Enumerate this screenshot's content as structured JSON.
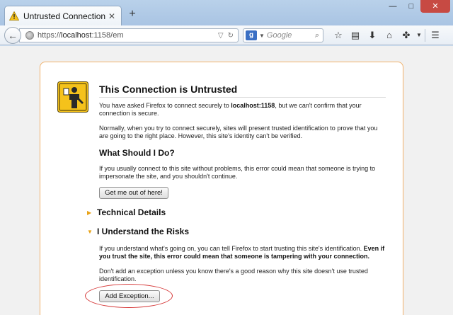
{
  "browser": {
    "tab_title": "Untrusted Connection",
    "new_tab_label": "+",
    "window_controls": {
      "minimize": "—",
      "maximize": "□",
      "close": "✕"
    },
    "url": {
      "prefix": "https://",
      "host": "localhost",
      "rest": ":1158/em"
    },
    "search": {
      "engine": "g",
      "placeholder": "Google"
    },
    "icons": [
      "star-icon",
      "clipboard-icon",
      "download-icon",
      "home-icon",
      "extension-icon",
      "menu-icon"
    ]
  },
  "page": {
    "title": "This Connection is Untrusted",
    "intro_prefix": "You have asked Firefox to connect securely to ",
    "intro_host": "localhost:1158",
    "intro_suffix": ", but we can't confirm that your connection is secure.",
    "normally": "Normally, when you try to connect securely, sites will present trusted identification to prove that you are going to the right place. However, this site's identity can't be verified.",
    "what_heading": "What Should I Do?",
    "what_text": "If you usually connect to this site without problems, this error could mean that someone is trying to impersonate the site, and you shouldn't continue.",
    "get_out_button": "Get me out of here!",
    "technical_details": "Technical Details",
    "understand_risks": "I Understand the Risks",
    "risks_text_plain": "If you understand what's going on, you can tell Firefox to start trusting this site's identification. ",
    "risks_text_bold": "Even if you trust the site, this error could mean that someone is tampering with your connection.",
    "dont_add": "Don't add an exception unless you know there's a good reason why this site doesn't use trusted identification.",
    "add_exception_button": "Add Exception...",
    "accent_color": "#e8a216",
    "annotation_color": "#d63b3b"
  }
}
